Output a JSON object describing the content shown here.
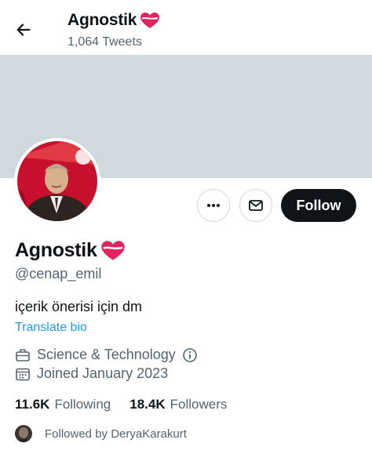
{
  "header": {
    "title": "Agnostik",
    "tweet_count": "1,064 Tweets"
  },
  "colors": {
    "banner": "#cfd9de",
    "follow_button": "#0f1419",
    "link": "#1d9bf0",
    "heart": "#e0245e"
  },
  "actions": {
    "follow_label": "Follow",
    "more_icon": "more-icon",
    "message_icon": "envelope-icon"
  },
  "profile": {
    "name": "Agnostik",
    "handle": "@cenap_emil",
    "bio": "içerik önerisi için dm",
    "translate_label": "Translate bio",
    "category": "Science & Technology",
    "joined": "Joined January 2023"
  },
  "stats": {
    "following_count": "11.6K",
    "following_label": "Following",
    "followers_count": "18.4K",
    "followers_label": "Followers"
  },
  "followed_by": "Followed by DeryaKarakurt"
}
